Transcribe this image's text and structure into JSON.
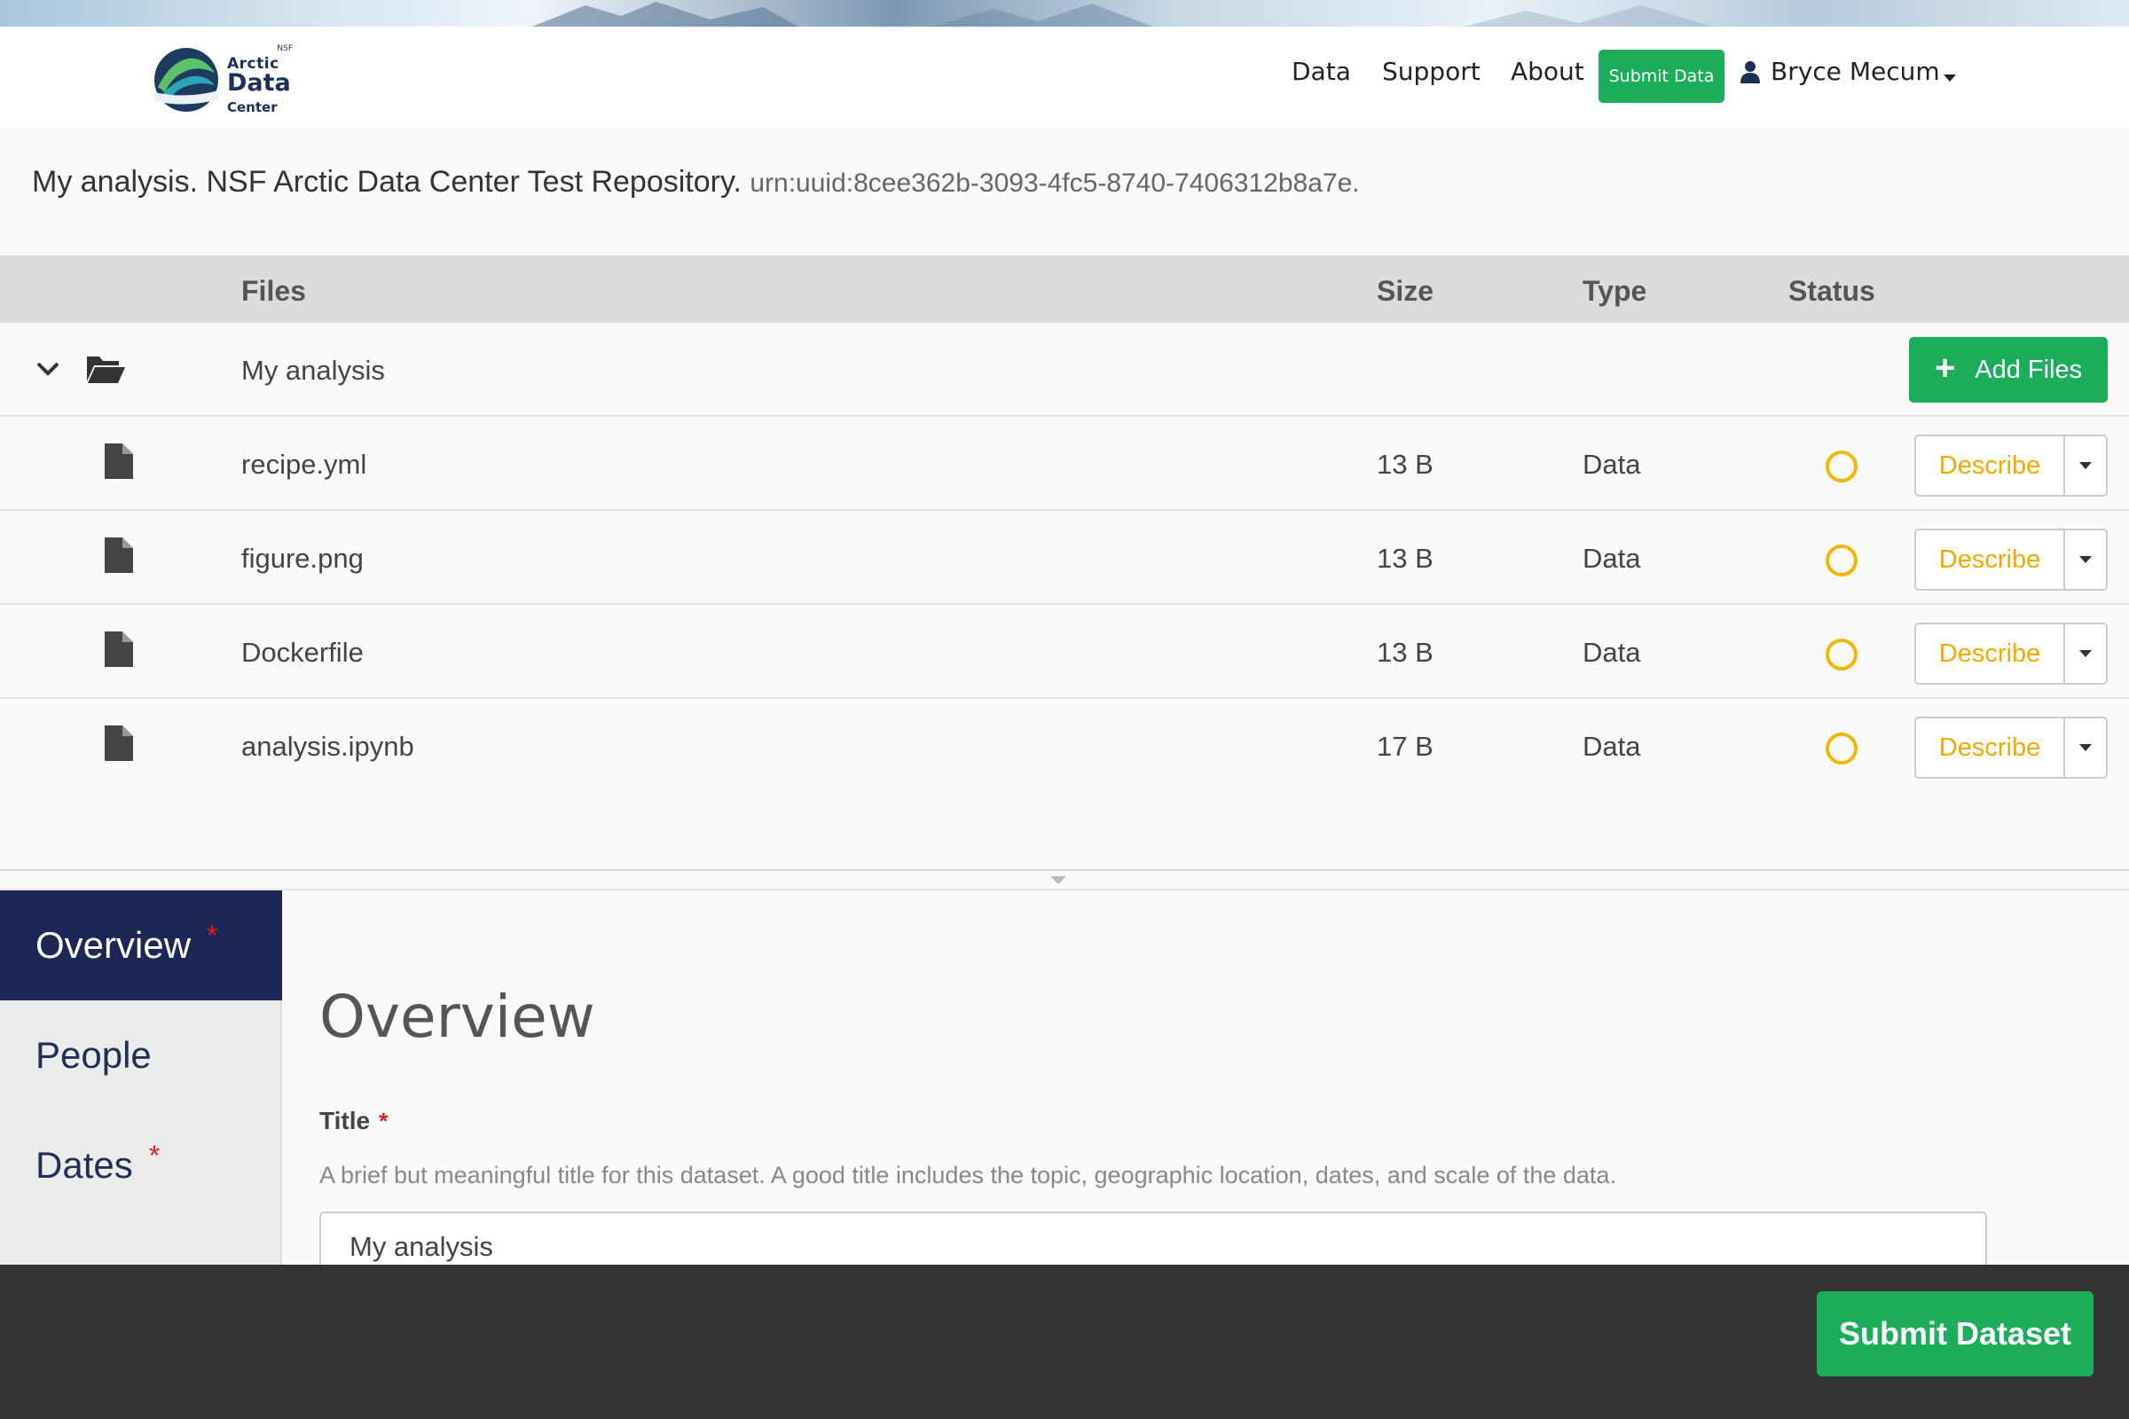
{
  "header": {
    "logo": {
      "nsf": "NSF",
      "arctic": "Arctic",
      "data": "Data",
      "center": "Center"
    },
    "nav": {
      "data": "Data",
      "support": "Support",
      "about": "About",
      "submit": "Submit Data"
    },
    "user": {
      "name": "Bryce Mecum",
      "icon": "user-icon"
    }
  },
  "package": {
    "title": "My analysis. NSF Arctic Data Center Test Repository.",
    "identifier": "urn:uuid:8cee362b-3093-4fc5-8740-7406312b8a7e."
  },
  "table": {
    "columns": {
      "files": "Files",
      "size": "Size",
      "type": "Type",
      "status": "Status"
    },
    "folder": {
      "name": "My analysis",
      "add_files_label": "Add Files"
    },
    "files": [
      {
        "name": "recipe.yml",
        "size": "13 B",
        "type": "Data",
        "action": "Describe"
      },
      {
        "name": "figure.png",
        "size": "13 B",
        "type": "Data",
        "action": "Describe"
      },
      {
        "name": "Dockerfile",
        "size": "13 B",
        "type": "Data",
        "action": "Describe"
      },
      {
        "name": "analysis.ipynb",
        "size": "17 B",
        "type": "Data",
        "action": "Describe"
      }
    ]
  },
  "sidebar": {
    "items": [
      {
        "label": "Overview",
        "required": "*"
      },
      {
        "label": "People",
        "required": ""
      },
      {
        "label": "Dates",
        "required": "*"
      }
    ]
  },
  "form": {
    "heading": "Overview",
    "title_label": "Title",
    "title_required": "*",
    "title_help": "A brief but meaningful title for this dataset. A good title includes the topic, geographic location, dates, and scale of the data.",
    "title_value": "My analysis"
  },
  "footer": {
    "submit_label": "Submit Dataset"
  },
  "colors": {
    "accent_green": "#1cad5b",
    "status_pending": "#f2b705",
    "nav_dark": "#1d2654"
  }
}
